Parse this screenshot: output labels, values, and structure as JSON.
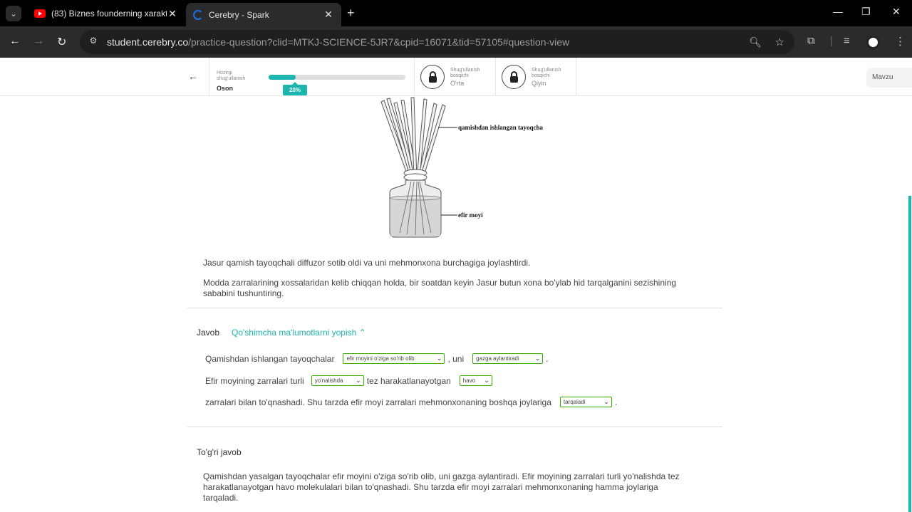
{
  "browser": {
    "tabs": [
      {
        "title": "(83) Biznes founderning xarakte",
        "active": false,
        "icon": "youtube-icon"
      },
      {
        "title": "Cerebry - Spark",
        "active": true,
        "icon": "cerebry-icon"
      }
    ],
    "url_host": "student.cerebry.co",
    "url_path": "/practice-question?clid=MTKJ-SCIENCE-5JR7&cpid=16071&tid=57105#question-view"
  },
  "header": {
    "current_caption": "Hozirgi shug'ullanish",
    "current_level": "Oson",
    "progress_label": "20%",
    "progress_fraction": 0.2,
    "level2_caption": "Shug'ullanish bosqichi",
    "level2_name": "O'rta",
    "level3_caption": "Shug'ullanish bosqichi",
    "level3_name": "Qiyin",
    "topic_button": "Mavzu"
  },
  "figure": {
    "label_stick": "qamishdan ishlangan tayoqcha",
    "label_oil": "efir moyi"
  },
  "question": {
    "p1": "Jasur qamish tayoqchali diffuzor sotib oldi va uni mehmonxona burchagiga joylashtirdi.",
    "p2": "Modda zarralarining xossalaridan kelib chiqqan holda, bir soatdan keyin Jasur butun xona bo'ylab hid tarqalganini sezishining sababini tushuntiring."
  },
  "answer": {
    "label": "Javob",
    "toggle": "Qo'shimcha ma'lumotlarni yopish",
    "line1_a": "Qamishdan ishlangan tayoqchalar",
    "sel1": "efir moyini o'ziga so'rib olib",
    "line1_b": ", uni",
    "sel2": "gazga aylantiradi",
    "line1_end": ".",
    "line2_a": "Efir moyining zarralari turli",
    "sel3": "yo'nalishda",
    "line2_b": "tez harakatlanayotgan",
    "sel4": "havo",
    "line3_a": "zarralari bilan to'qnashadi. Shu tarzda efir moyi zarralari mehmonxonaning boshqa joylariga",
    "sel5": "tarqaladi",
    "line3_end": "."
  },
  "correct": {
    "label": "To'g'ri javob",
    "text": "Qamishdan yasalgan tayoqchalar efir moyini o'ziga so'rib olib, uni gazga aylantiradi. Efir moyining zarralari turli yo'nalishda tez harakatlanayotgan havo molekulalari bilan to'qnashadi. Shu tarzda efir moyi zarralari mehmonxonaning hamma joylariga tarqaladi."
  },
  "colors": {
    "accent": "#1cb5b0",
    "select_border": "#38b000"
  }
}
